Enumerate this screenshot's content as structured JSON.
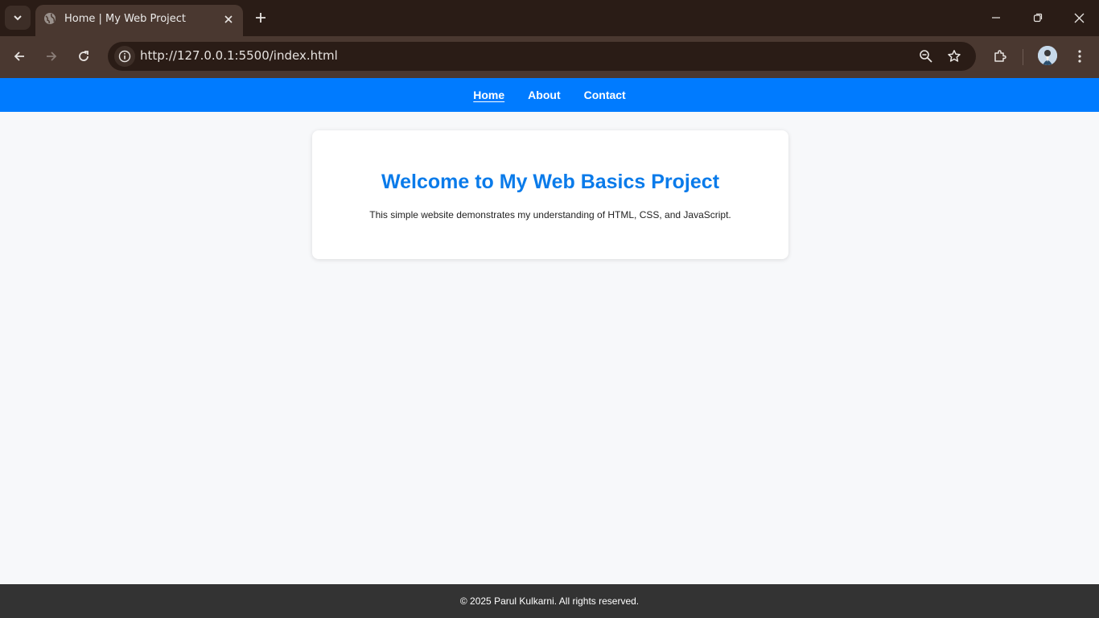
{
  "browser": {
    "tab_title": "Home | My Web Project",
    "url": "http://127.0.0.1:5500/index.html",
    "icons": [
      "tab-search-icon",
      "globe-icon",
      "close-icon",
      "plus-icon",
      "minimize-icon",
      "restore-icon",
      "window-close-icon",
      "back-icon",
      "forward-icon",
      "reload-icon",
      "site-info-icon",
      "zoom-icon",
      "star-icon",
      "extensions-icon",
      "avatar",
      "menu-icon"
    ]
  },
  "nav": {
    "items": [
      {
        "label": "Home",
        "active": true
      },
      {
        "label": "About",
        "active": false
      },
      {
        "label": "Contact",
        "active": false
      }
    ],
    "bg_color": "#007bff"
  },
  "main": {
    "heading": "Welcome to My Web Basics Project",
    "description": "This simple website demonstrates my understanding of HTML, CSS, and JavaScript.",
    "heading_color": "#0a7bea"
  },
  "footer": {
    "text": "© 2025 Parul Kulkarni. All rights reserved.",
    "bg_color": "#333333"
  }
}
